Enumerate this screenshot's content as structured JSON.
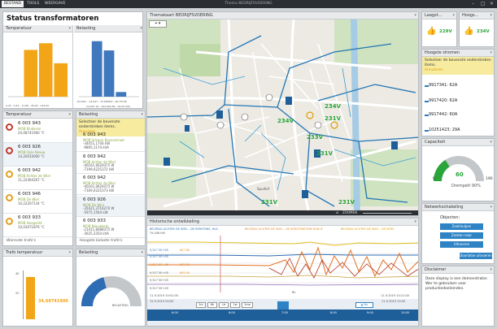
{
  "app": {
    "window_title": "Thema BEDRIJFSVOERING",
    "tabs": [
      "BESTAND",
      "TOOLS",
      "WEERGAVE"
    ]
  },
  "status": {
    "title": "Status transformatoren",
    "temp_header": "Temperatuur",
    "belast_header": "Belasting"
  },
  "hist_left": {
    "labels": [
      "0,00 - 40,00",
      "40,00 - 80,00",
      "80,00 - 120,00",
      "120,00 - 160,00"
    ],
    "values": [
      0,
      14,
      16,
      10
    ],
    "ylim": [
      0,
      18
    ],
    "color": "#f2a516",
    "axis_text": "4,34 - 5,63 - 11,66 - 36,00 - 144,00"
  },
  "hist_right": {
    "values": [
      0,
      48,
      40,
      4,
      0
    ],
    "ylim": [
      0,
      52
    ],
    "color": "#3f78bd",
    "axis_text": "-64,930 - -14,007 - 10,6808,8 - 28,79746",
    "axis_text2": "-14,007 16 - 104,000 80 - 16,00 000"
  },
  "temp_list": {
    "header": "Temperatuur",
    "items": [
      {
        "name": "6 003 943",
        "sub1": "MOB Kinderen",
        "sub2": "24,08741900 °C",
        "ring": "red"
      },
      {
        "name": "6 003 926",
        "sub1": "MOB Oyle Nieuw",
        "sub2": "14,20010000 °C",
        "ring": "red"
      },
      {
        "name": "6 003 942",
        "sub1": "MOB Achter de Wiel",
        "sub2": "11,22404267 °C",
        "ring": "yellow"
      },
      {
        "name": "6 003 946",
        "sub1": "MOB De Wiel",
        "sub2": "10,22207134 °C",
        "ring": "yellow"
      },
      {
        "name": "6 003 933",
        "sub1": "MOB Hoogveld",
        "sub2": "10,03071876 °C",
        "ring": "yellow"
      }
    ],
    "footer": "Warmste trafo's"
  },
  "belast_list": {
    "header": "Belasting",
    "note": "Selecteer de bovenste onderstreken items.",
    "note_link": "Annuleer",
    "items": [
      {
        "name": "6 003 943",
        "sub1": "MOB Schoon Bovenstraat",
        "sub2": "-34051,1744 kW",
        "sub3": "-9895,1174 kVA"
      },
      {
        "name": "6 003 942",
        "sub1": "MOB Achter de Wiel",
        "sub2": "-40161,6629375 W",
        "sub3": "-7199,0225372 kW"
      },
      {
        "name": "6 003 942",
        "sub1": "MOB Achter de Wiel",
        "sub2": "-40161,0629375 W",
        "sub3": "-7169,0225373 kW"
      },
      {
        "name": "6 003 926",
        "sub1": "MOB De Wiel",
        "sub2": "-35421,3716270 W",
        "sub3": "-5975,1564 kW"
      },
      {
        "name": "6 003 933",
        "sub1": "MOB Nieuwkerk",
        "sub2": "-21411,6688375 W",
        "sub3": "-3625,3354 kVA"
      }
    ],
    "footer": "Hoogste belaste trafo's"
  },
  "trafo_temp": {
    "header": "Trafo temperatuur",
    "value_label": "34,68741900",
    "value": 34.69,
    "ylim": [
      0,
      40
    ],
    "ticks": [
      "40",
      "20"
    ]
  },
  "belasting2": {
    "header": "Belasting",
    "gauge_label": "BELASTING"
  },
  "map": {
    "title": "Themakaart BEDRIJFSVOERING",
    "labels": [
      "234V",
      "231V",
      "233V",
      "231V",
      "234V",
      "231V",
      "231V"
    ],
    "zoom_label": "ZOOMEN",
    "street": "Spuihof"
  },
  "history": {
    "header": "Historische ontwikkeling",
    "legend": [
      "BELTRAG ACHTER DE WIEL - DE KERSTENS, HLD",
      "BELTRAG ACHTER DE WIEL - DE KERSTENSTEIN FASE B",
      "BELTRAG ACHTER DE WIEL - DE KERS",
      "79,446 kW"
    ],
    "row_labels": [
      "9,517 5E+05",
      "9,517 5E+05",
      "9,517 5E+05",
      "9,517 5E+05",
      "9,517 5E+05",
      "9,517 5E+05"
    ],
    "row_vals": [
      "607 60",
      "607 00",
      "600 00"
    ],
    "date_left": "11-9-2019 10:01:00",
    "date_right": "11-9-2019 10:21:00",
    "mid_label": "6h",
    "time_left": "12-9-2019 04:00",
    "time_right": "11-9-2019 10:00",
    "buttons": [
      "1m",
      "6h",
      "1d",
      "1w",
      "1mo"
    ],
    "now_button": "Nu",
    "axis_times": [
      "6:00",
      "6:00",
      "7:00",
      "8:00",
      "9:00",
      "10:00"
    ]
  },
  "right": {
    "laagst": "Laagst...",
    "hoogst": "Hoogs...",
    "v_low": "229V",
    "v_high": "234V",
    "hv_header": "Hoogste stromen",
    "hv_note": "Selecteer de bovenste onderstreken items.",
    "hv_link": "Annuleren",
    "hv_items": [
      "9917341: 62A",
      "9917420: 62A",
      "9917442: 60A",
      "10251423: 29A"
    ],
    "cap_header": "Capaciteit",
    "cap_value": "60",
    "cap_min": "0",
    "cap_max": "190",
    "cap_text": "Drempelt 90%",
    "cap_fraction": 0.32,
    "net_header": "Netwerkschakeling",
    "net_label": "Objecten:",
    "net_buttons": [
      "Zoekhulpen",
      "Zoeken naar",
      "Uitvoeren"
    ],
    "net_extra": "Doorlatse uitvoeren",
    "disclaimer_header": "Disclaimer",
    "disclaimer_text": "Deze display is een demonstrator. Wer te gebruiken voor productiedoeleinden."
  }
}
